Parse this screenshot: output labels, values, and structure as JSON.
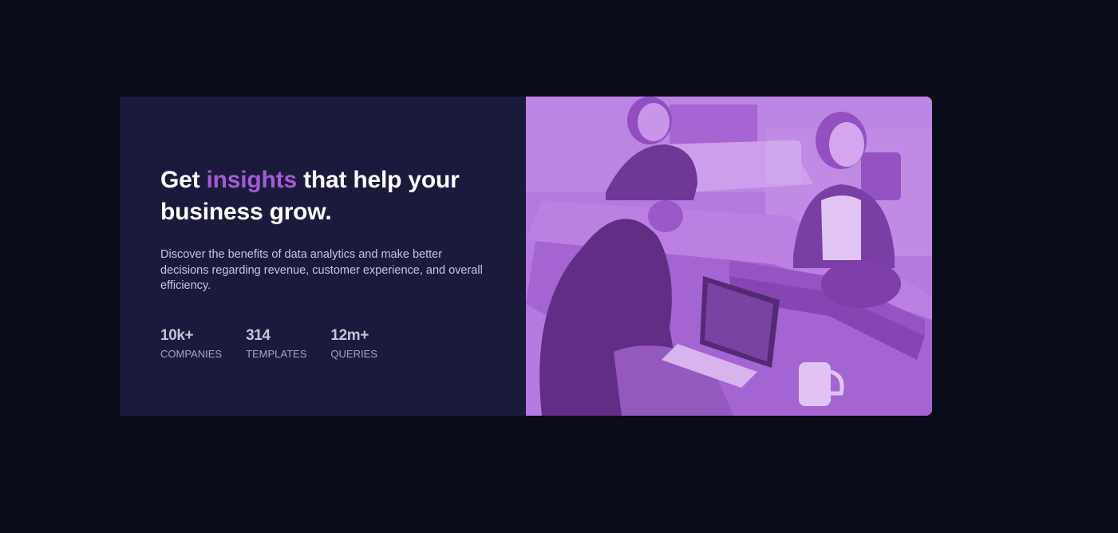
{
  "hero": {
    "headline_before": "Get ",
    "headline_accent": "insights",
    "headline_after": " that help your business grow.",
    "subtitle": "Discover the benefits of data analytics and make better decisions regarding revenue, customer experience, and overall efficiency."
  },
  "stats": [
    {
      "value": "10k+",
      "label": "COMPANIES"
    },
    {
      "value": "314",
      "label": "TEMPLATES"
    },
    {
      "value": "12m+",
      "label": "QUERIES"
    }
  ],
  "image": {
    "description_icon": "office-team-photo",
    "overlay_color": "#aa5cdb"
  },
  "colors": {
    "page_background": "#0a0c1b",
    "card_background": "#1b1a3c",
    "accent": "#a55bd4",
    "heading": "#ffffff",
    "body_text": "#c9c6dc"
  }
}
